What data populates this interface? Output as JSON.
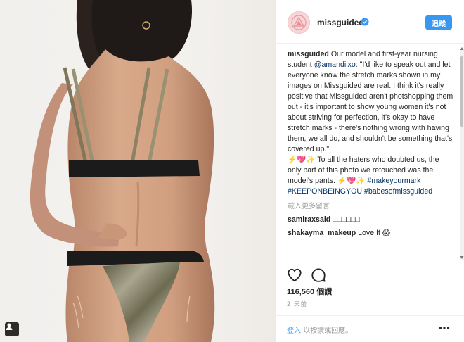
{
  "header": {
    "username": "missguided",
    "follow_label": "追蹤"
  },
  "post": {
    "caption_user": "missguided",
    "caption_pre": " Our model and first-year nursing student ",
    "caption_mention": "@amandiixo",
    "caption_body": ": \"I'd like to speak out and let everyone know the stretch marks shown in my images on Missguided are real. I think it's really positive that Missguided aren't photshopping them out - it's important to show young women it's not about striving for perfection, it's okay to have stretch marks - there's nothing wrong with having them, we all do, and shouldn't be something that's covered up.\"\n⚡️💖✨ To all the haters who doubted us, the only part of this photo we retouched was the model's pants. ⚡️💖✨ ",
    "hashtags": [
      "#makeyourmark",
      "#KEEPONBEINGYOU",
      "#babesofmissguided"
    ],
    "load_more": "載入更多留言",
    "comments": [
      {
        "user": "samiraxsaid",
        "text": "□□□□□□"
      },
      {
        "user": "shakayma_makeup",
        "text": "Love It 😱"
      }
    ],
    "views": "116,560 個讚",
    "time": "2 天前"
  },
  "footer": {
    "login_link": "登入",
    "login_rest": " 以按讚或回應。"
  },
  "icons": {
    "like": "heart-icon",
    "comment": "speech-bubble-icon",
    "more": "more-dots-icon",
    "verified": "verified-badge-icon",
    "tag": "user-tag-icon",
    "avatar": "missguided-triangle-logo"
  },
  "colors": {
    "follow_button": "#3897f0",
    "link": "#003569",
    "muted": "#999999",
    "avatar_bg": "#f7d6d8"
  }
}
